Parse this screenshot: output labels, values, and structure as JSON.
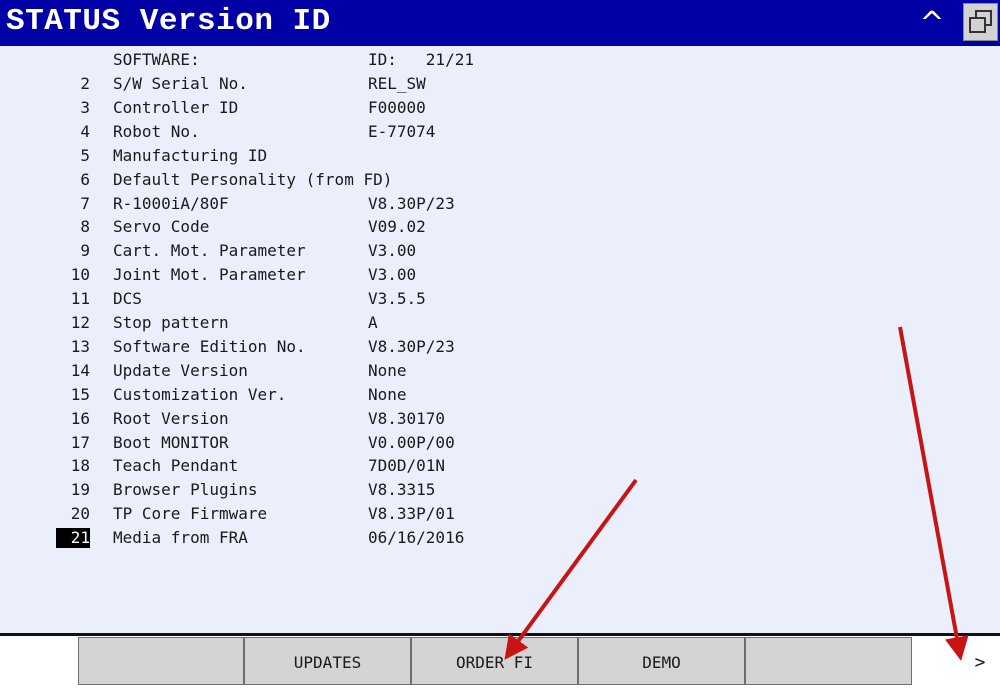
{
  "window": {
    "title": "STATUS Version ID",
    "caret_glyph": "^",
    "window_icon": "restore-windows-icon"
  },
  "header": {
    "software_label": "SOFTWARE:",
    "id_label": "ID:   21/21"
  },
  "rows": [
    {
      "num": "2",
      "label": "S/W Serial No.",
      "value": "REL_SW"
    },
    {
      "num": "3",
      "label": "Controller ID",
      "value": "F00000"
    },
    {
      "num": "4",
      "label": "Robot No.",
      "value": "E-77074"
    },
    {
      "num": "5",
      "label": "Manufacturing ID",
      "value": ""
    },
    {
      "num": "6",
      "label": "Default Personality (from FD)",
      "value": ""
    },
    {
      "num": "7",
      "label": "R-1000iA/80F",
      "value": "V8.30P/23"
    },
    {
      "num": "8",
      "label": "Servo Code",
      "value": "V09.02"
    },
    {
      "num": "9",
      "label": "Cart. Mot. Parameter",
      "value": "V3.00"
    },
    {
      "num": "10",
      "label": "Joint Mot. Parameter",
      "value": "V3.00"
    },
    {
      "num": "11",
      "label": "DCS",
      "value": "V3.5.5"
    },
    {
      "num": "12",
      "label": "Stop pattern",
      "value": "A"
    },
    {
      "num": "13",
      "label": "Software Edition No.",
      "value": "V8.30P/23"
    },
    {
      "num": "14",
      "label": "Update Version",
      "value": "None"
    },
    {
      "num": "15",
      "label": "Customization Ver.",
      "value": "None"
    },
    {
      "num": "16",
      "label": "Root Version",
      "value": "V8.30170"
    },
    {
      "num": "17",
      "label": "Boot MONITOR",
      "value": "V0.00P/00"
    },
    {
      "num": "18",
      "label": "Teach Pendant",
      "value": "7D0D/01N"
    },
    {
      "num": "19",
      "label": "Browser Plugins",
      "value": "V8.3315"
    },
    {
      "num": "20",
      "label": "TP Core Firmware",
      "value": "V8.33P/01"
    },
    {
      "num": "21",
      "label": "Media from FRA",
      "value": "06/16/2016"
    }
  ],
  "selected_row_num": "21",
  "function_keys": {
    "f1": "",
    "f2": "UPDATES",
    "f3": "ORDER FI",
    "f4": "DEMO",
    "f5": "",
    "next": ">"
  },
  "annotation_color": "#c81414",
  "colors": {
    "title_bar": "#0000a4",
    "content_bg": "#ebeffb",
    "fkey_bg": "#d4d4d4"
  }
}
